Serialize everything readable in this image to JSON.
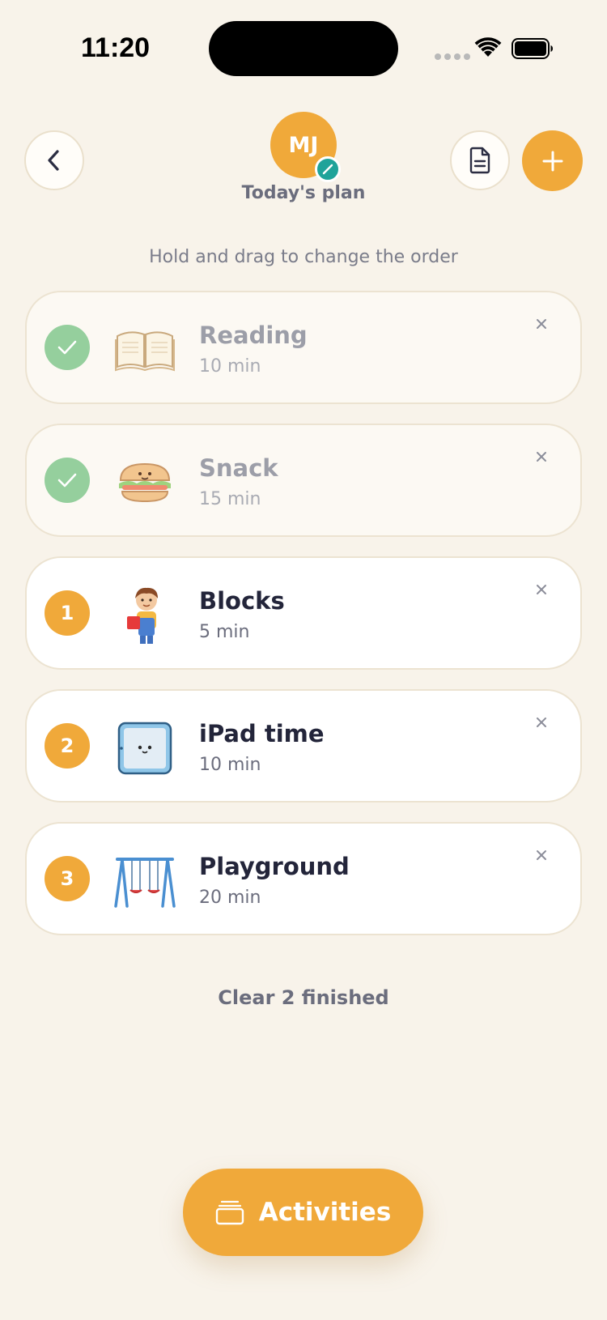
{
  "status_bar": {
    "time": "11:20"
  },
  "header": {
    "avatar_initials": "MJ",
    "title": "Today's plan"
  },
  "hint": "Hold and drag to change the order",
  "activities": [
    {
      "name": "Reading",
      "duration": "10 min",
      "status": "done",
      "icon": "open-book-icon"
    },
    {
      "name": "Snack",
      "duration": "15 min",
      "status": "done",
      "icon": "sandwich-icon"
    },
    {
      "name": "Blocks",
      "duration": "5 min",
      "status": "todo",
      "order": "1",
      "icon": "child-with-block-icon"
    },
    {
      "name": "iPad time",
      "duration": "10 min",
      "status": "todo",
      "order": "2",
      "icon": "tablet-icon"
    },
    {
      "name": "Playground",
      "duration": "20 min",
      "status": "todo",
      "order": "3",
      "icon": "swing-set-icon"
    }
  ],
  "clear_label": "Clear 2 finished",
  "activities_button": {
    "label": "Activities",
    "icon": "cards-stack-icon"
  },
  "colors": {
    "accent": "#f0a93a",
    "done": "#95cf9d",
    "badge": "#1fa39a",
    "background": "#f8f3ea"
  }
}
